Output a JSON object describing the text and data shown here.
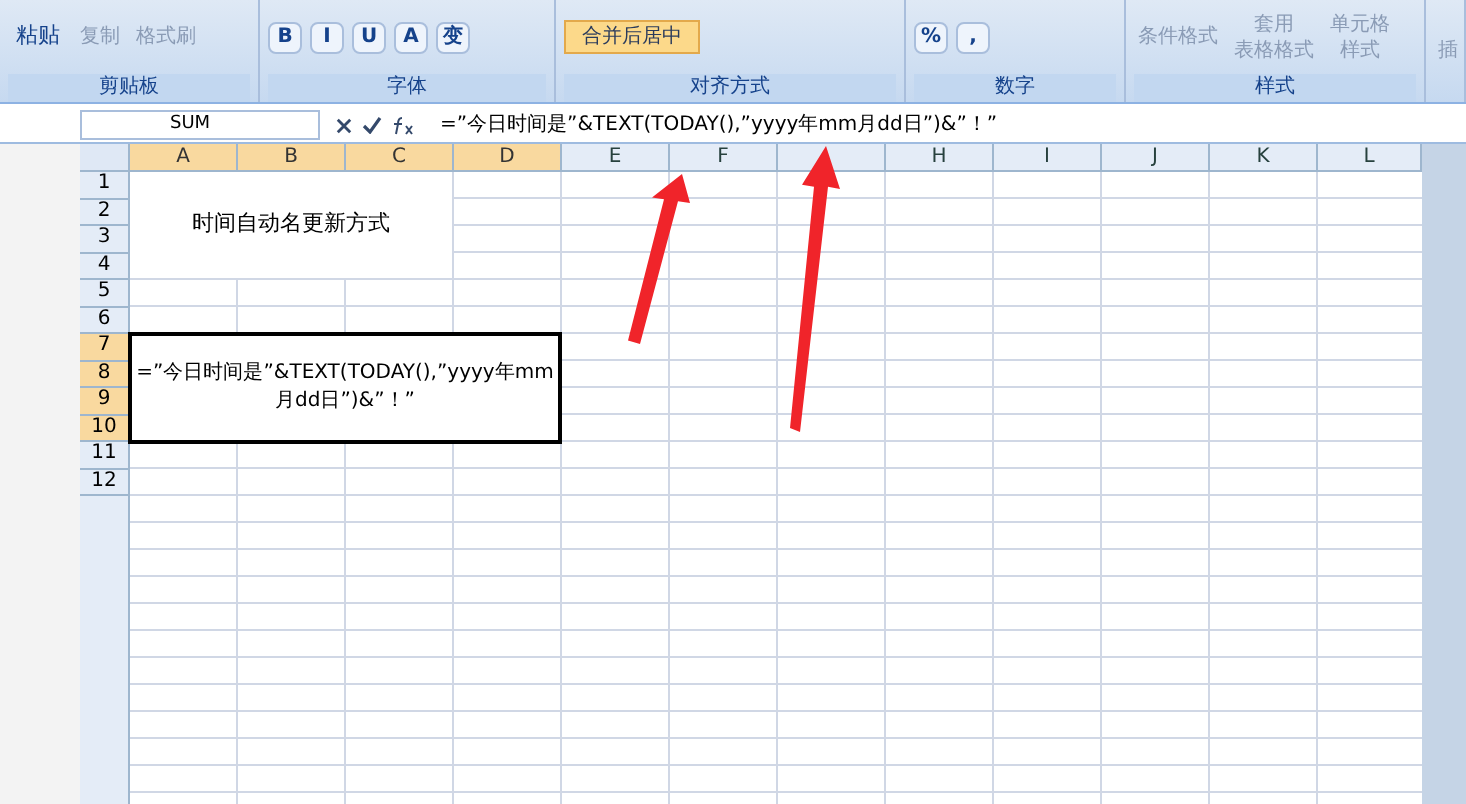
{
  "ribbon": {
    "groups": [
      {
        "label": "剪贴板",
        "buttons": [
          {
            "lines": [
              "粘贴"
            ],
            "kind": "large"
          },
          {
            "lines": [
              "复制"
            ],
            "kind": "small"
          },
          {
            "lines": [
              "格式刷"
            ],
            "kind": "small"
          }
        ]
      },
      {
        "label": "字体",
        "buttons": [
          {
            "lines": [
              "B"
            ],
            "kind": "tool"
          },
          {
            "lines": [
              "I"
            ],
            "kind": "tool"
          },
          {
            "lines": [
              "U"
            ],
            "kind": "tool"
          },
          {
            "lines": [
              "A"
            ],
            "kind": "tool"
          },
          {
            "lines": [
              "变"
            ],
            "kind": "tool"
          }
        ]
      },
      {
        "label": "对齐方式",
        "buttons": [
          {
            "lines": [
              "合并后居中"
            ],
            "kind": "highlight"
          }
        ]
      },
      {
        "label": "数字",
        "buttons": [
          {
            "lines": [
              "%"
            ],
            "kind": "tool"
          },
          {
            "lines": [
              ","
            ],
            "kind": "tool"
          }
        ]
      },
      {
        "label": "样式",
        "buttons": [
          {
            "lines": [
              "条件格式"
            ],
            "kind": "small"
          },
          {
            "lines": [
              "套用",
              "表格格式"
            ],
            "kind": "small"
          },
          {
            "lines": [
              "单元格",
              "样式"
            ],
            "kind": "small"
          }
        ]
      },
      {
        "buttons": [
          {
            "lines": [
              "插"
            ],
            "kind": "small"
          }
        ]
      }
    ]
  },
  "formula_bar": {
    "name_box": "SUM",
    "formula": "=”今日时间是”&TEXT(TODAY(),”yyyy年mm月dd日”)&”！”"
  },
  "columns": [
    {
      "label": "A",
      "selected": true
    },
    {
      "label": "B",
      "selected": true
    },
    {
      "label": "C",
      "selected": true
    },
    {
      "label": "D",
      "selected": true
    },
    {
      "label": "E",
      "selected": false
    },
    {
      "label": "F",
      "selected": false
    },
    {
      "selected": false
    },
    {
      "label": "H",
      "selected": false
    },
    {
      "label": "I",
      "selected": false
    },
    {
      "label": "J",
      "selected": false
    },
    {
      "label": "K",
      "selected": false
    },
    {
      "label": "L",
      "selected": false
    }
  ],
  "rows": [
    {
      "label": "1",
      "selected": false
    },
    {
      "label": "2",
      "selected": false
    },
    {
      "label": "3",
      "selected": false
    },
    {
      "label": "4",
      "selected": false
    },
    {
      "label": "5",
      "selected": false
    },
    {
      "label": "6",
      "selected": false
    },
    {
      "label": "7",
      "selected": true
    },
    {
      "label": "8",
      "selected": true
    },
    {
      "label": "9",
      "selected": true
    },
    {
      "label": "10",
      "selected": true
    },
    {
      "label": "11",
      "selected": false
    },
    {
      "label": "12",
      "selected": false
    }
  ],
  "merged_title": "时间自动名更新方式",
  "merged_formula": "=”今日时间是”&TEXT(TODAY(),”yyyy年mm月dd日”)&”！”"
}
